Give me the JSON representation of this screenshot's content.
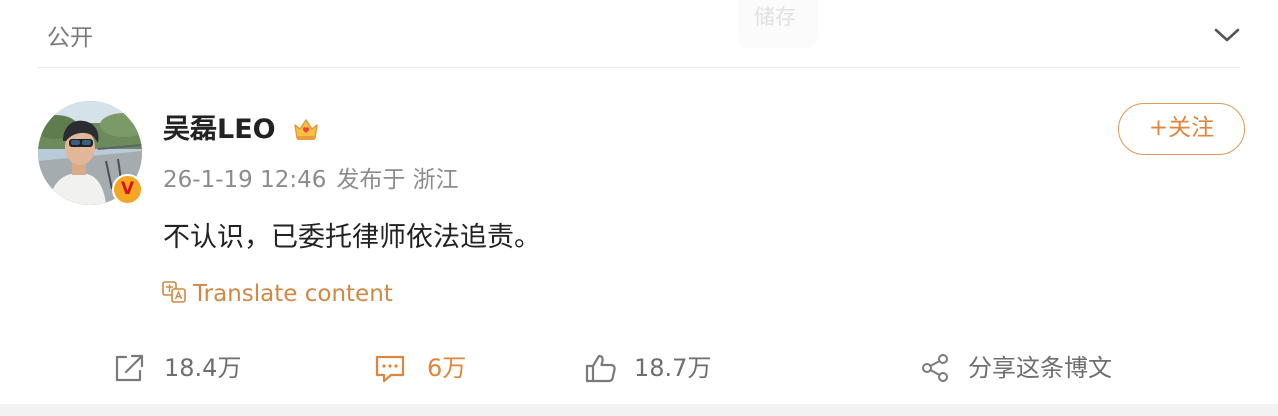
{
  "header": {
    "visibility": "公开",
    "save_label": "储存"
  },
  "post": {
    "username": "吴磊LEO",
    "timestamp": "26-1-19 12:46",
    "published_from": "发布于 浙江",
    "follow_label": "+关注",
    "text": "不认识，已委托律师依法追责。",
    "translate_label": "Translate content"
  },
  "actions": {
    "repost_count": "18.4万",
    "comment_count": "6万",
    "like_count": "18.7万",
    "share_label": "分享这条博文"
  },
  "colors": {
    "accent": "#e0853c",
    "follow_border": "#e29857",
    "muted_text": "#8c8c8c",
    "verify_badge": "#f5a623"
  },
  "icons": {
    "collapse": "chevron-down-icon",
    "verify": "verified-v-icon",
    "member": "crown-icon",
    "translate": "translate-icon",
    "repost": "repost-icon",
    "comment": "comment-icon",
    "like": "thumbs-up-icon",
    "share": "share-icon"
  }
}
